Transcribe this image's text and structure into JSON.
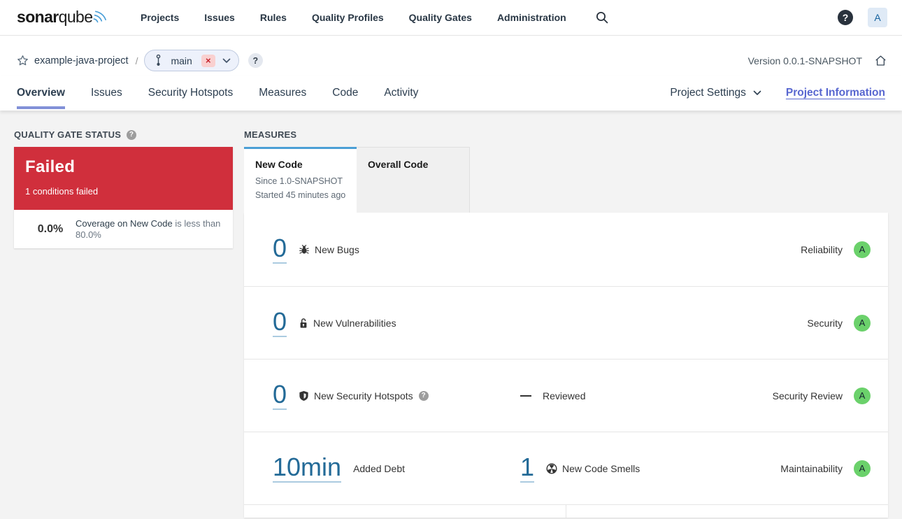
{
  "brand": {
    "bold": "sonar",
    "light": "qube"
  },
  "topnav": {
    "items": [
      "Projects",
      "Issues",
      "Rules",
      "Quality Profiles",
      "Quality Gates",
      "Administration"
    ],
    "help": "?",
    "avatar": "A"
  },
  "breadcrumb": {
    "project": "example-java-project",
    "separator": "/",
    "branch": "main",
    "branch_close": "×",
    "help": "?",
    "version": "Version 0.0.1-SNAPSHOT"
  },
  "tabs": {
    "items": [
      "Overview",
      "Issues",
      "Security Hotspots",
      "Measures",
      "Code",
      "Activity"
    ],
    "active": "Overview",
    "project_settings": "Project Settings",
    "project_information": "Project Information"
  },
  "quality_gate": {
    "heading": "QUALITY GATE STATUS",
    "help": "?",
    "status": "Failed",
    "conditions_summary": "1 conditions failed",
    "condition": {
      "value": "0.0%",
      "metric": "Coverage on New Code",
      "comparison": "is less than 80.0%"
    }
  },
  "measures": {
    "heading": "MEASURES",
    "new_code_tab": {
      "label": "New Code",
      "since": "Since 1.0-SNAPSHOT",
      "started": "Started 45 minutes ago"
    },
    "overall_tab": "Overall Code",
    "rows": [
      {
        "value": "0",
        "label": "New Bugs",
        "domain": "Reliability",
        "rating": "A"
      },
      {
        "value": "0",
        "label": "New Vulnerabilities",
        "domain": "Security",
        "rating": "A"
      },
      {
        "value": "0",
        "label": "New Security Hotspots",
        "help": "?",
        "reviewed": "Reviewed",
        "domain": "Security Review",
        "rating": "A"
      },
      {
        "value": "10min",
        "label": "Added Debt",
        "value2": "1",
        "label2": "New Code Smells",
        "domain": "Maintainability",
        "rating": "A"
      }
    ]
  },
  "colors": {
    "failed_red": "#d02f3c",
    "link_blue": "#236a97",
    "rating_a_green": "#6bd16b",
    "active_tab_blue": "#4b9fd5",
    "accent_purple": "#8291d8"
  }
}
